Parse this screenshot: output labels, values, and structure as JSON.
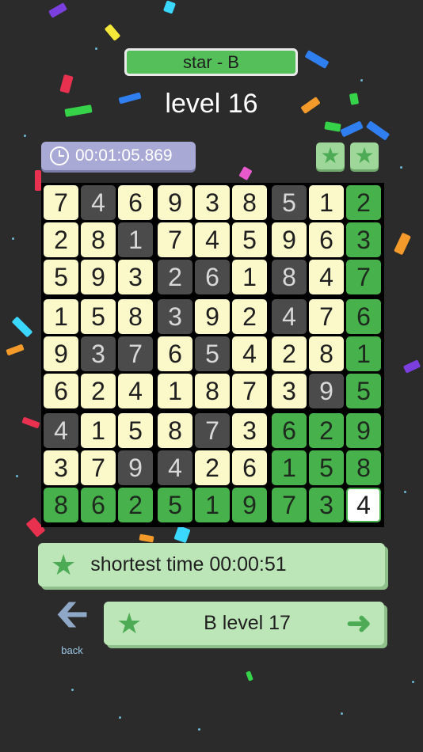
{
  "header": {
    "mode_label": "star - B",
    "level_title": "level 16"
  },
  "timer": {
    "icon": "clock-icon",
    "value": "00:01:05.869"
  },
  "rating": {
    "stars_earned": 2,
    "icon": "star-icon"
  },
  "board": {
    "rows": [
      {
        "cells": [
          {
            "v": "7",
            "s": "c"
          },
          {
            "v": "4",
            "s": "d"
          },
          {
            "v": "6",
            "s": "c"
          },
          {
            "v": "9",
            "s": "c"
          },
          {
            "v": "3",
            "s": "c"
          },
          {
            "v": "8",
            "s": "c"
          },
          {
            "v": "5",
            "s": "d"
          },
          {
            "v": "1",
            "s": "c"
          },
          {
            "v": "2",
            "s": "g"
          }
        ]
      },
      {
        "cells": [
          {
            "v": "2",
            "s": "c"
          },
          {
            "v": "8",
            "s": "c"
          },
          {
            "v": "1",
            "s": "d"
          },
          {
            "v": "7",
            "s": "c"
          },
          {
            "v": "4",
            "s": "c"
          },
          {
            "v": "5",
            "s": "c"
          },
          {
            "v": "9",
            "s": "c"
          },
          {
            "v": "6",
            "s": "c"
          },
          {
            "v": "3",
            "s": "g"
          }
        ]
      },
      {
        "cells": [
          {
            "v": "5",
            "s": "c"
          },
          {
            "v": "9",
            "s": "c"
          },
          {
            "v": "3",
            "s": "c"
          },
          {
            "v": "2",
            "s": "d"
          },
          {
            "v": "6",
            "s": "d"
          },
          {
            "v": "1",
            "s": "c"
          },
          {
            "v": "8",
            "s": "d"
          },
          {
            "v": "4",
            "s": "c"
          },
          {
            "v": "7",
            "s": "g"
          }
        ]
      },
      {
        "cells": [
          {
            "v": "1",
            "s": "c"
          },
          {
            "v": "5",
            "s": "c"
          },
          {
            "v": "8",
            "s": "c"
          },
          {
            "v": "3",
            "s": "d"
          },
          {
            "v": "9",
            "s": "c"
          },
          {
            "v": "2",
            "s": "c"
          },
          {
            "v": "4",
            "s": "d"
          },
          {
            "v": "7",
            "s": "c"
          },
          {
            "v": "6",
            "s": "g"
          }
        ]
      },
      {
        "cells": [
          {
            "v": "9",
            "s": "c"
          },
          {
            "v": "3",
            "s": "d"
          },
          {
            "v": "7",
            "s": "d"
          },
          {
            "v": "6",
            "s": "c"
          },
          {
            "v": "5",
            "s": "d"
          },
          {
            "v": "4",
            "s": "c"
          },
          {
            "v": "2",
            "s": "c"
          },
          {
            "v": "8",
            "s": "c"
          },
          {
            "v": "1",
            "s": "g"
          }
        ]
      },
      {
        "cells": [
          {
            "v": "6",
            "s": "c"
          },
          {
            "v": "2",
            "s": "c"
          },
          {
            "v": "4",
            "s": "c"
          },
          {
            "v": "1",
            "s": "c"
          },
          {
            "v": "8",
            "s": "c"
          },
          {
            "v": "7",
            "s": "c"
          },
          {
            "v": "3",
            "s": "c"
          },
          {
            "v": "9",
            "s": "d"
          },
          {
            "v": "5",
            "s": "g"
          }
        ]
      },
      {
        "cells": [
          {
            "v": "4",
            "s": "d"
          },
          {
            "v": "1",
            "s": "c"
          },
          {
            "v": "5",
            "s": "c"
          },
          {
            "v": "8",
            "s": "c"
          },
          {
            "v": "7",
            "s": "d"
          },
          {
            "v": "3",
            "s": "c"
          },
          {
            "v": "6",
            "s": "g"
          },
          {
            "v": "2",
            "s": "g"
          },
          {
            "v": "9",
            "s": "g"
          }
        ]
      },
      {
        "cells": [
          {
            "v": "3",
            "s": "c"
          },
          {
            "v": "7",
            "s": "c"
          },
          {
            "v": "9",
            "s": "d"
          },
          {
            "v": "4",
            "s": "d"
          },
          {
            "v": "2",
            "s": "c"
          },
          {
            "v": "6",
            "s": "c"
          },
          {
            "v": "1",
            "s": "g"
          },
          {
            "v": "5",
            "s": "g"
          },
          {
            "v": "8",
            "s": "g"
          }
        ]
      },
      {
        "cells": [
          {
            "v": "8",
            "s": "g"
          },
          {
            "v": "6",
            "s": "g"
          },
          {
            "v": "2",
            "s": "g"
          },
          {
            "v": "5",
            "s": "g"
          },
          {
            "v": "1",
            "s": "g"
          },
          {
            "v": "9",
            "s": "g"
          },
          {
            "v": "7",
            "s": "g"
          },
          {
            "v": "3",
            "s": "g"
          },
          {
            "v": "4",
            "s": "w"
          }
        ]
      }
    ]
  },
  "record": {
    "icon": "star-icon",
    "label": "shortest time 00:00:51"
  },
  "navigation": {
    "back_icon": "arrow-left-icon",
    "back_label": "back",
    "next_icon": "star-icon",
    "next_label": "B level 17",
    "next_arrow_icon": "arrow-right-icon"
  },
  "colors": {
    "background": "#2b2b2b",
    "cream_cell": "#fbf8c9",
    "dark_cell": "#4b4b4b",
    "green_cell": "#47b14c",
    "panel_green": "#bde6b8",
    "timer_purple": "#a9a9d6"
  }
}
